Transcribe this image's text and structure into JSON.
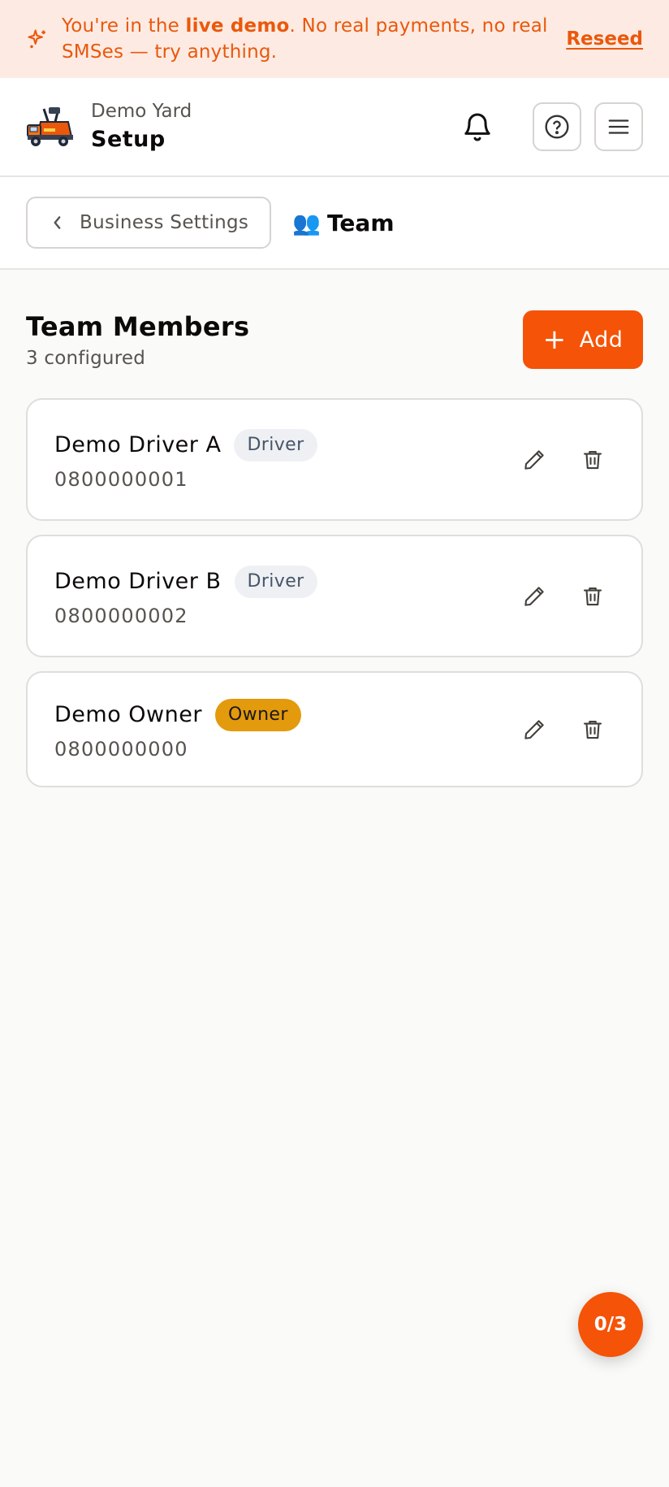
{
  "banner": {
    "text_before": "You're in the ",
    "text_bold": "live demo",
    "text_after": ". No real payments, no real SMSes — try anything.",
    "reseed_label": "Reseed",
    "icon": "sparkles-icon"
  },
  "header": {
    "business_name": "Demo Yard",
    "page_title": "Setup",
    "icons": [
      "logo-truck-icon",
      "bell-icon",
      "help-icon",
      "menu-icon"
    ]
  },
  "subnav": {
    "back_label": "Business Settings",
    "section_emoji": "👥",
    "section_title": "Team"
  },
  "team": {
    "heading": "Team Members",
    "count_label": "3 configured",
    "add_label": "Add",
    "members": [
      {
        "name": "Demo Driver A",
        "role": "Driver",
        "phone": "0800000001"
      },
      {
        "name": "Demo Driver B",
        "role": "Driver",
        "phone": "0800000002"
      },
      {
        "name": "Demo Owner",
        "role": "Owner",
        "phone": "0800000000"
      }
    ]
  },
  "progress_fab": {
    "label": "0/3"
  },
  "colors": {
    "accent": "#f55307",
    "banner_bg": "#fdebe3",
    "owner_badge": "#e39a0d",
    "driver_badge": "#eef0f3"
  }
}
